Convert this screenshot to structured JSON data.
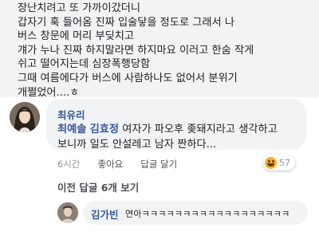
{
  "post": {
    "text": "장난치려고 또 가까이갔더니\n갑자기 훅 들어옴 진짜 입술닿을 정도로 그래서 나\n버스 창문에 머리 부딪치고\n걔가 누나 진짜 하지말라면 하지마요 이러고 한숨 작게\n쉬고 떨어지는데 심장폭행당함\n그때 여름에다가 버스에 사람하나도 없어서 분위기\n개쩔었어....ㅎ"
  },
  "comment": {
    "author": "최유리",
    "mention_1": "최예솔",
    "mention_2": "김효정",
    "text_line1": " 여자가 파오후 좆돼지라고 생각하고",
    "text_line2": "보니까 일도 안설레고 남자 짠하다...",
    "time": "6시간",
    "like_label": "좋아요",
    "reply_label": "답글 달기",
    "reaction_count": "57"
  },
  "replies": {
    "more_label": "이전 답글 6개 보기",
    "reply_author": "김가빈",
    "reply_text": "연아ㅋㅋㅋㅋㅋㅋㅋㅋㅋㅋㅋㅋㅋㅋㅋㅋㅋㅋ"
  },
  "colors": {
    "link": "#385898",
    "bubble": "#f2f3f5",
    "muted": "#90949c",
    "haha_emoji": "#f7b125"
  },
  "icons": [
    "profile-avatar",
    "haha-emoji-icon",
    "reply-avatar"
  ]
}
